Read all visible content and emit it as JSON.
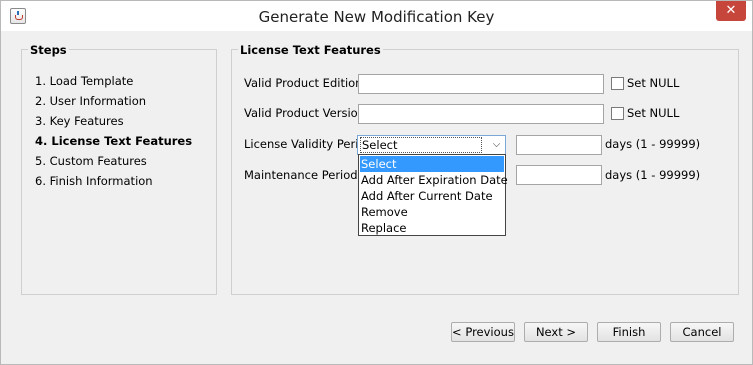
{
  "window": {
    "title": "Generate New Modification Key",
    "close_label": "✕"
  },
  "steps": {
    "title": "Steps",
    "items": [
      {
        "label": "1. Load Template"
      },
      {
        "label": "2. User Information"
      },
      {
        "label": "3. Key Features"
      },
      {
        "label": "4. License Text Features",
        "active": true
      },
      {
        "label": "5. Custom Features"
      },
      {
        "label": "6. Finish Information"
      }
    ]
  },
  "features": {
    "title": "License Text Features",
    "product_edition": {
      "label": "Valid Product Edition:",
      "value": "",
      "set_null_label": "Set NULL",
      "set_null_checked": false
    },
    "product_version": {
      "label": "Valid Product Version:",
      "value": "",
      "set_null_label": "Set NULL",
      "set_null_checked": false
    },
    "validity_period": {
      "label": "License Validity Period:",
      "selected": "Select",
      "options": [
        "Select",
        "Add After Expiration Date",
        "Add After Current Date",
        "Remove",
        "Replace"
      ],
      "highlighted_option": "Select",
      "days_value": "",
      "days_hint": "days (1 - 99999)"
    },
    "maintenance_period": {
      "label": "Maintenance Period:",
      "days_value": "",
      "days_hint": "days (1 - 99999)"
    }
  },
  "buttons": {
    "previous": "< Previous",
    "next": "Next  >",
    "finish": "Finish",
    "cancel": "Cancel"
  },
  "colors": {
    "highlight": "#3399ff",
    "close": "#c7463b"
  }
}
